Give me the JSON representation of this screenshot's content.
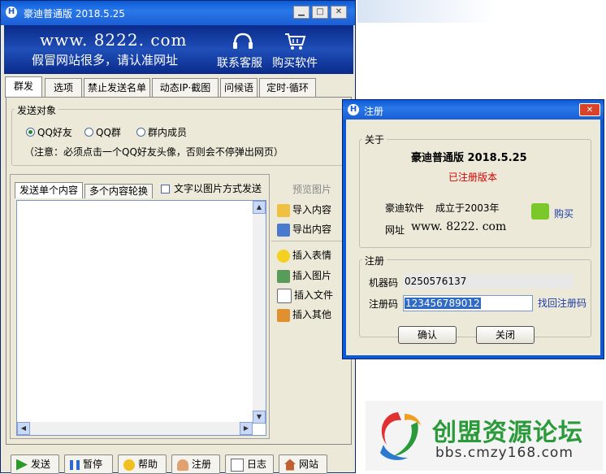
{
  "main_window": {
    "title": "豪迪普通版 2018.5.25",
    "banner": {
      "site": "www. 8222. com",
      "slogan": "假冒网站很多，请认准网址",
      "contact_label": "联系客服",
      "buy_label": "购买软件"
    },
    "tabs": [
      "群发",
      "选项",
      "禁止发送名单",
      "动态IP·截图",
      "问候语",
      "定时·循环"
    ],
    "target_group": {
      "label": "发送对象",
      "options": [
        "QQ好友",
        "QQ群",
        "群内成员"
      ],
      "selected": "QQ好友",
      "note": "（注意：必须点击一个QQ好友头像，否则会不停弹出网页）"
    },
    "content_tabs": [
      "发送单个内容",
      "多个内容轮换"
    ],
    "image_send_checkbox": "文字以图片方式发送",
    "preview_label": "预览图片",
    "side_buttons": [
      "导入内容",
      "导出内容",
      "插入表情",
      "插入图片",
      "插入文件",
      "插入其他"
    ],
    "bottom_buttons": [
      "发送",
      "暂停",
      "帮助",
      "注册",
      "日志",
      "网站"
    ]
  },
  "dialog": {
    "title": "注册",
    "about": {
      "label": "关于",
      "product": "豪迪普通版 2018.5.25",
      "status": "已注册版本",
      "company": "豪迪软件",
      "founded": "成立于2003年",
      "site_label": "网址",
      "site_url": "www. 8222. com",
      "buy": "购买"
    },
    "register": {
      "label": "注册",
      "machine_label": "机器码",
      "machine_code": "0250576137",
      "code_label": "注册码",
      "code_value": "123456789012",
      "recover_link": "找回注册码"
    },
    "ok": "确认",
    "close": "关闭"
  },
  "watermark": {
    "name": "创盟资源论坛",
    "url": "bbs.cmzy168.com"
  },
  "colors": {
    "titlebar": "#1a5ed6",
    "banner": "#0a2a8a",
    "status_red": "#d00000",
    "link_blue": "#1a3aa8",
    "watermark_green": "#2a9a3a"
  }
}
